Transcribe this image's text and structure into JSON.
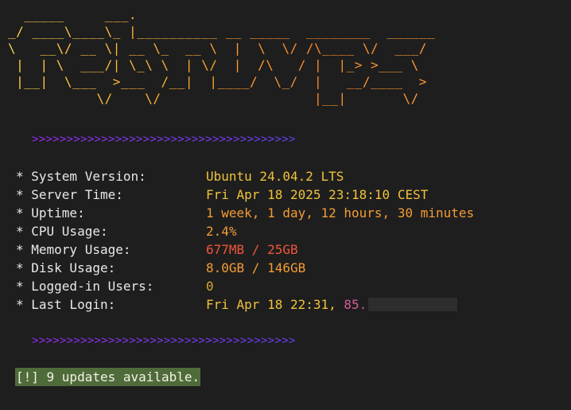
{
  "banner": {
    "ascii_art": "  _____     ___.                              \n_/ ____\\____\\_ |__________ __ _____  ________  ______\n\\   __\\/ __ \\| __ \\_  __ \\  |  \\  \\/ /\\____ \\/  ___/\n |  | \\  ___/| \\_\\ \\  | \\/  |  /\\   / |  |_> >___ \\ \n |__|  \\___  >___  /__|  |____/  \\_/  |   __/____  >\n           \\/    \\/                   |__|       \\/ "
  },
  "dividers": {
    "top": ">>>>>>>>>>>>>>>>>>>>>>>>>>>>>>>>>>>>>>",
    "bottom": ">>>>>>>>>>>>>>>>>>>>>>>>>>>>>>>>>>>>>>"
  },
  "info": {
    "system_version": {
      "label": "* System Version:",
      "value": "Ubuntu 24.04.2 LTS"
    },
    "server_time": {
      "label": "* Server Time:",
      "value": "Fri Apr 18 2025 23:18:10 CEST"
    },
    "uptime": {
      "label": "* Uptime:",
      "value": "1 week, 1 day, 12 hours, 30 minutes"
    },
    "cpu_usage": {
      "label": "* CPU Usage:",
      "value": "2.4%"
    },
    "memory_usage": {
      "label": "* Memory Usage:",
      "value": "677MB / 25GB"
    },
    "disk_usage": {
      "label": "* Disk Usage:",
      "value": "8.0GB / 146GB"
    },
    "logged_in_users": {
      "label": "* Logged-in Users:",
      "value": "0"
    },
    "last_login": {
      "label": "* Last Login:",
      "value": "Fri Apr 18 22:31, ",
      "ip_prefix": "85."
    }
  },
  "updates": {
    "message": "[!] 9 updates available."
  },
  "colors": {
    "background": "#1e1e1e",
    "banner_yellow": "#ffd84a",
    "banner_orange": "#ff8a2a",
    "divider_purple": "#9a2cf2",
    "value_yellow": "#f0c23b",
    "value_orange": "#f39c33",
    "value_red": "#f0553b",
    "ip_pink": "#d65b98",
    "updates_bg": "#4f6b3a"
  }
}
